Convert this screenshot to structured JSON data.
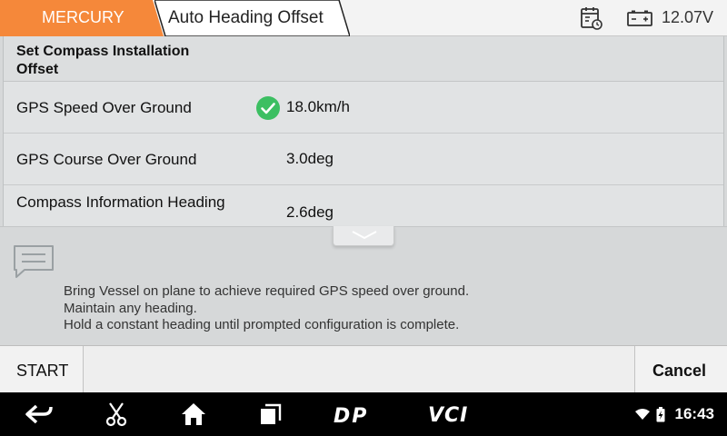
{
  "topbar": {
    "brand_tab": "MERCURY",
    "title_tab": "Auto Heading Offset",
    "voltage": "12.07V",
    "accent_color": "#f5883a"
  },
  "panel": {
    "header": "Set Compass Installation Offset",
    "rows": [
      {
        "label": "GPS Speed Over Ground",
        "value": "18.0km/h",
        "status": "ok"
      },
      {
        "label": "GPS Course Over Ground",
        "value": "3.0deg"
      },
      {
        "label": "Compass Information  Heading",
        "value": "2.6deg"
      }
    ]
  },
  "message": {
    "lines": [
      "Bring Vessel on plane to achieve required GPS speed over ground.",
      "Maintain any heading.",
      "Hold a constant heading until prompted configuration is complete."
    ]
  },
  "buttons": {
    "start": "START",
    "cancel": "Cancel"
  },
  "navbar": {
    "icons": [
      "back-icon",
      "scissors-icon",
      "home-icon",
      "recent-apps-icon",
      "dp-icon",
      "vci-icon"
    ],
    "dp_label": "DP",
    "vci_label": "VCI",
    "clock": "16:43"
  }
}
